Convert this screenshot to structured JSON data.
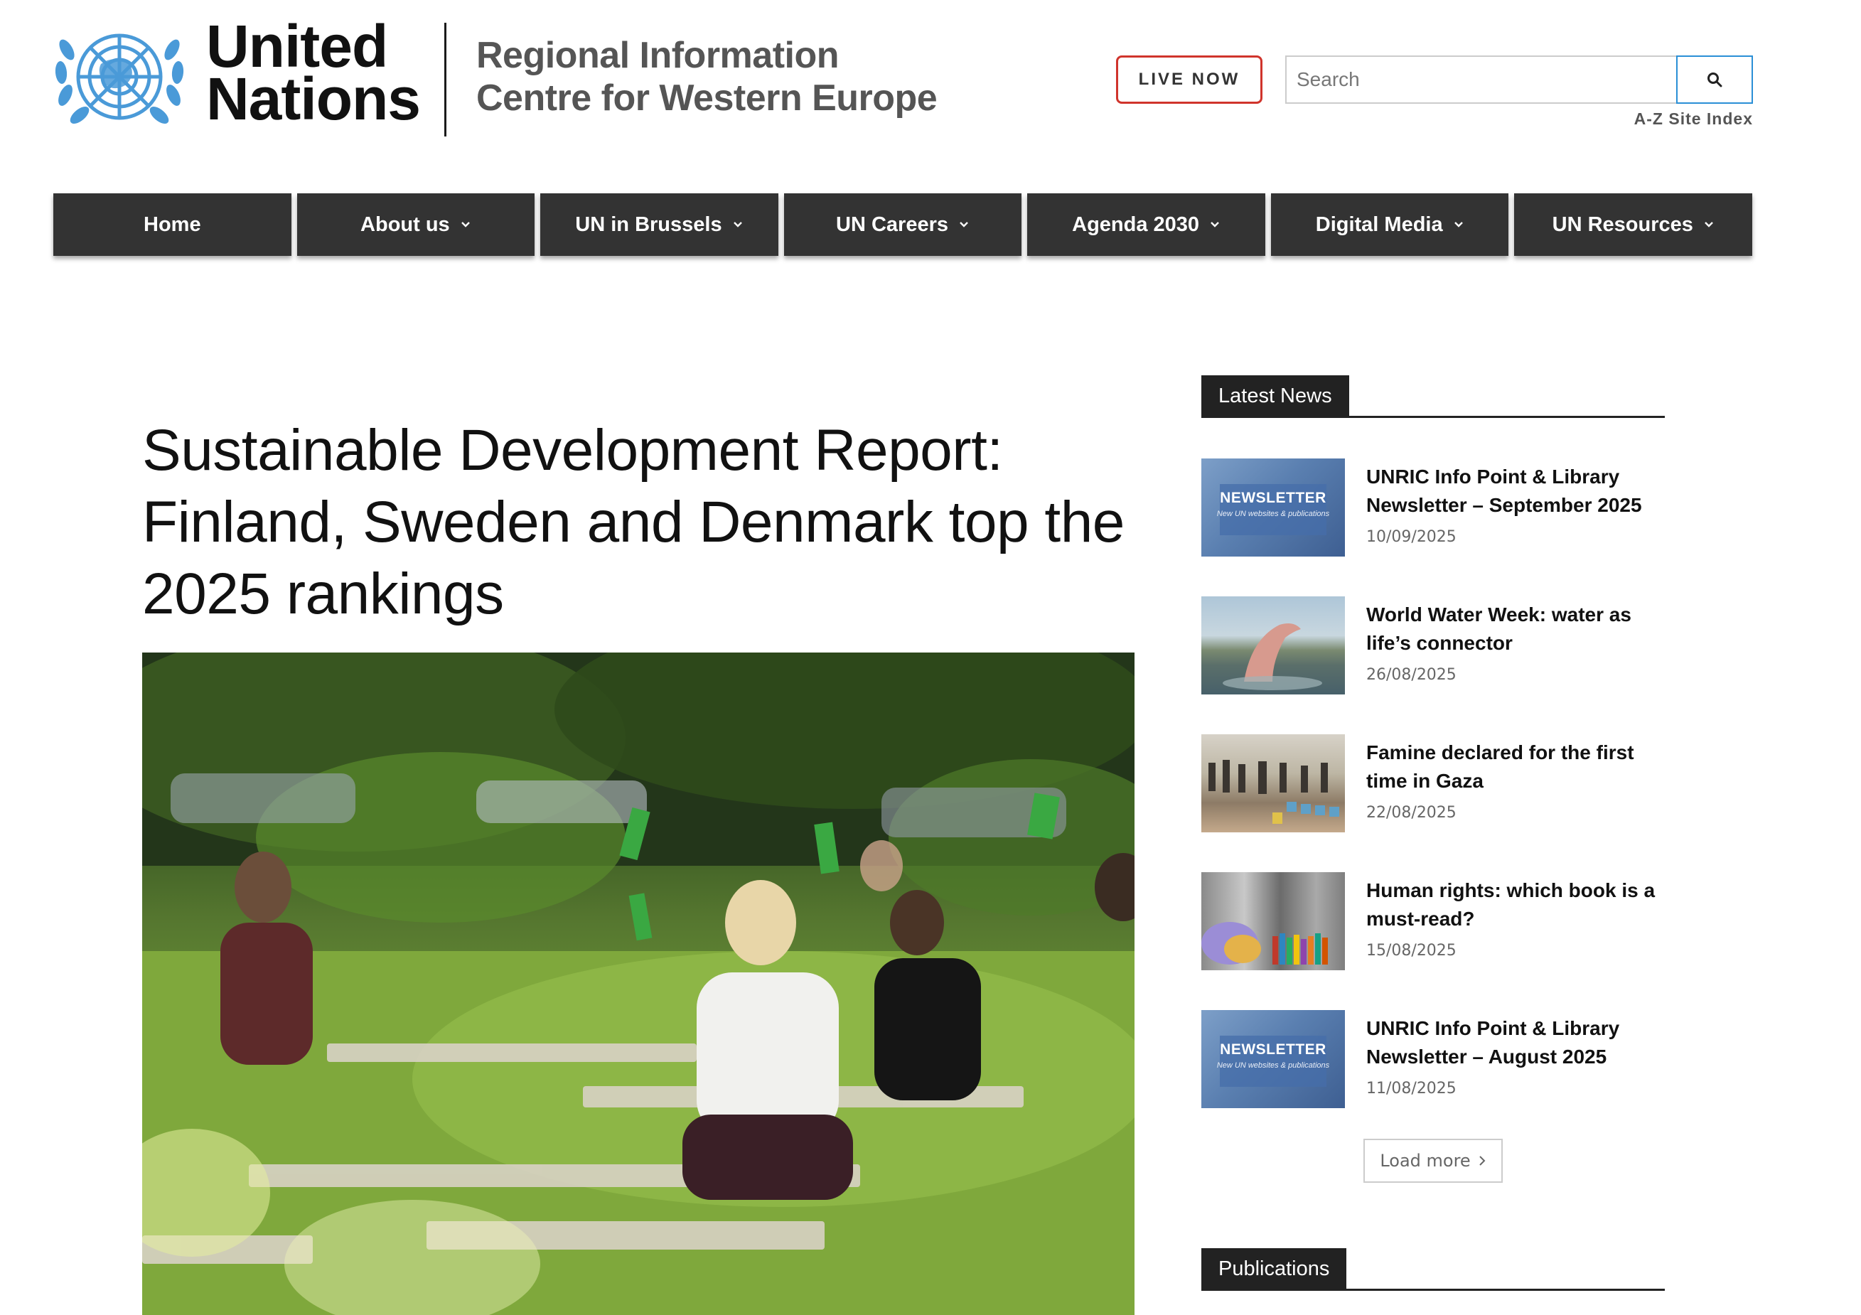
{
  "header": {
    "logo_line1": "United",
    "logo_line2": "Nations",
    "centre_line1": "Regional Information",
    "centre_line2": "Centre for Western Europe",
    "live_label": "LIVE NOW",
    "search_placeholder": "Search",
    "az_index": "A-Z Site Index"
  },
  "nav": {
    "items": [
      {
        "label": "Home",
        "dropdown": false
      },
      {
        "label": "About us",
        "dropdown": true
      },
      {
        "label": "UN in Brussels",
        "dropdown": true
      },
      {
        "label": "UN Careers",
        "dropdown": true
      },
      {
        "label": "Agenda 2030",
        "dropdown": true
      },
      {
        "label": "Digital Media",
        "dropdown": true
      },
      {
        "label": "UN Resources",
        "dropdown": true
      }
    ]
  },
  "article": {
    "title": "Sustainable Development Report: Finland, Sweden and Denmark top the 2025 rankings"
  },
  "sidebar": {
    "latest_news_title": "Latest News",
    "news": [
      {
        "title": "UNRIC Info Point & Library Newsletter – September 2025",
        "date": "10/09/2025",
        "thumb": "newsletter"
      },
      {
        "title": "World Water Week: water as life’s connector",
        "date": "26/08/2025",
        "thumb": "water"
      },
      {
        "title": "Famine declared for the first time in Gaza",
        "date": "22/08/2025",
        "thumb": "gaza"
      },
      {
        "title": "Human rights: which book is a must-read?",
        "date": "15/08/2025",
        "thumb": "books"
      },
      {
        "title": "UNRIC Info Point & Library Newsletter – August 2025",
        "date": "11/08/2025",
        "thumb": "newsletter"
      }
    ],
    "newsletter_thumb_label": "NEWSLETTER",
    "newsletter_thumb_sub": "New UN websites & publications",
    "load_more": "Load more",
    "publications_title": "Publications"
  },
  "colors": {
    "nav_bg": "#333333",
    "live_border": "#d0342c",
    "search_button_border": "#2a8fd6",
    "un_blue": "#4a9ad8"
  }
}
